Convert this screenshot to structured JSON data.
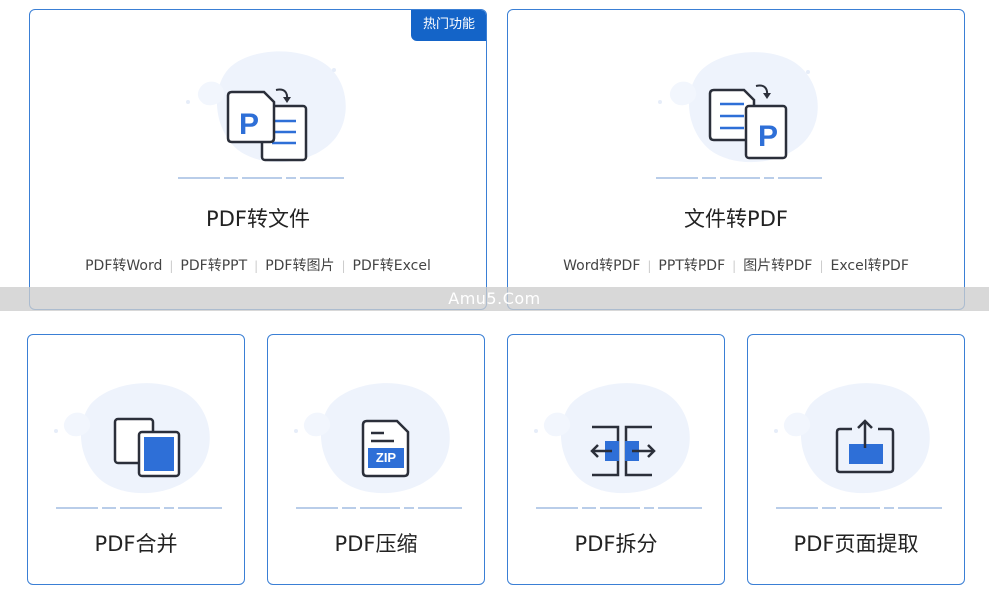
{
  "colors": {
    "accent": "#2e6fd7",
    "card_border": "#3a7fd5",
    "badge_bg": "#1464c8",
    "icon_stroke": "#2b2f3a",
    "baseline": "#b9cde9"
  },
  "cards": [
    {
      "title": "PDF转文件",
      "icon": "pdf-to-file-icon",
      "badge": "热门功能",
      "links": [
        "PDF转Word",
        "PDF转PPT",
        "PDF转图片",
        "PDF转Excel"
      ]
    },
    {
      "title": "文件转PDF",
      "icon": "file-to-pdf-icon",
      "links": [
        "Word转PDF",
        "PPT转PDF",
        "图片转PDF",
        "Excel转PDF"
      ]
    },
    {
      "title": "PDF合并",
      "icon": "pdf-merge-icon"
    },
    {
      "title": "PDF压缩",
      "icon": "pdf-compress-icon",
      "icon_label": "ZIP"
    },
    {
      "title": "PDF拆分",
      "icon": "pdf-split-icon"
    },
    {
      "title": "PDF页面提取",
      "icon": "pdf-page-extract-icon"
    }
  ],
  "watermark": "Amu5.Com"
}
